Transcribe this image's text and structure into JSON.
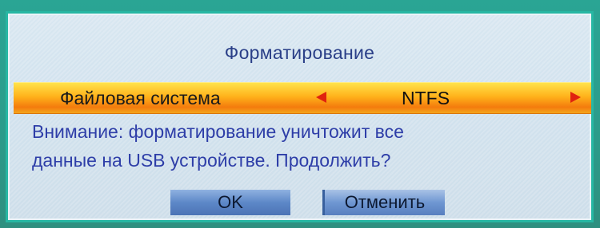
{
  "dialog": {
    "title": "Форматирование",
    "option": {
      "label": "Файловая система",
      "value": "NTFS"
    },
    "message_line1": "Внимание: форматирование уничтожит все",
    "message_line2": "данные на USB устройстве. Продолжить?",
    "ok_label": "OK",
    "cancel_label": "Отменить"
  },
  "colors": {
    "title_text": "#2a3f88",
    "message_text": "#2e3ea8",
    "highlight_bar": "#f7a21c",
    "arrow": "#e0230f",
    "button": "#5d88c8",
    "border": "#27b7a3"
  },
  "icons": {
    "left": "arrow-left-icon",
    "right": "arrow-right-icon"
  }
}
